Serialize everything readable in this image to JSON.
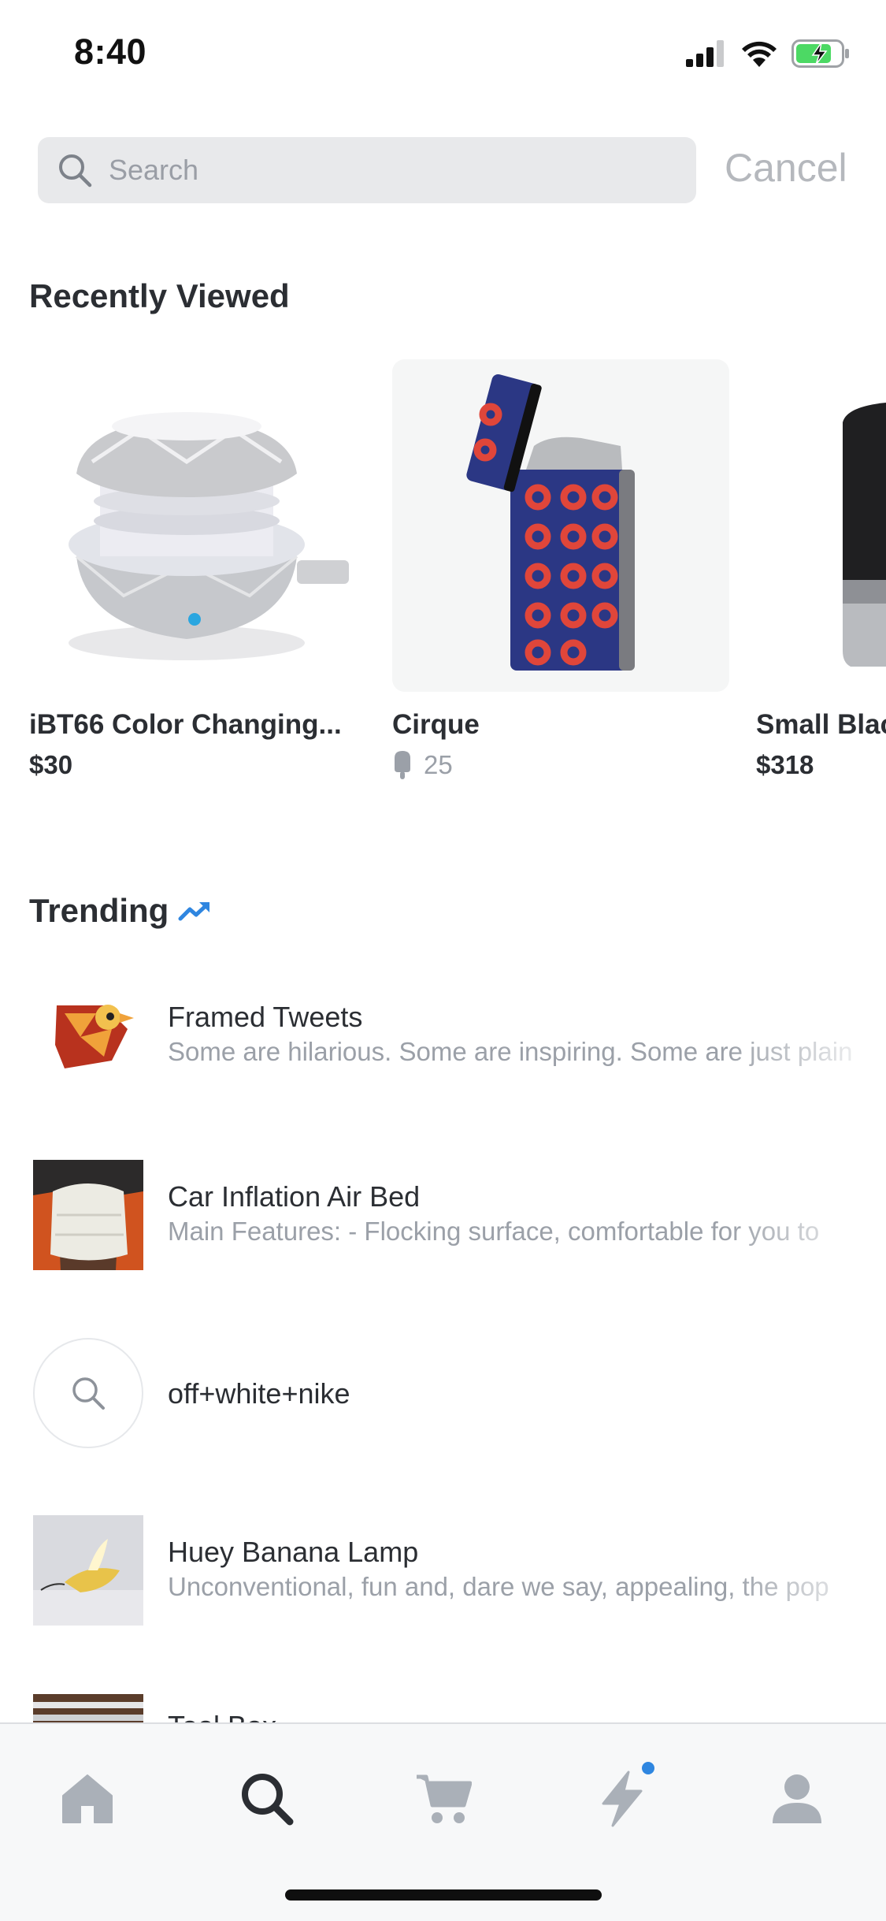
{
  "status_bar": {
    "time": "8:40"
  },
  "search": {
    "placeholder": "Search",
    "value": "",
    "cancel_label": "Cancel"
  },
  "recently_viewed": {
    "title": "Recently Viewed",
    "items": [
      {
        "title": "iBT66 Color Changing...",
        "price": "$30"
      },
      {
        "title": "Cirque",
        "count": "25"
      },
      {
        "title": "Small Black",
        "price": "$318"
      }
    ]
  },
  "trending": {
    "title": "Trending",
    "items": [
      {
        "title": "Framed Tweets",
        "description": "Some are hilarious. Some are inspiring. Some are just plain"
      },
      {
        "title": "Car Inflation Air Bed",
        "description": "Main Features: - Flocking surface, comfortable for you to"
      },
      {
        "title": "off+white+nike"
      },
      {
        "title": "Huey Banana Lamp",
        "description": "Unconventional, fun and, dare we say, appealing, the pop"
      },
      {
        "title": "Tool Box"
      }
    ]
  },
  "tab_bar": {
    "tabs": [
      {
        "icon": "home-icon",
        "active": false
      },
      {
        "icon": "search-icon",
        "active": true
      },
      {
        "icon": "cart-icon",
        "active": false
      },
      {
        "icon": "lightning-icon",
        "active": false,
        "badge": true
      },
      {
        "icon": "profile-icon",
        "active": false
      }
    ]
  },
  "colors": {
    "accent": "#2f86e0",
    "text": "#2b2e33",
    "muted": "#9ba0a8",
    "tab_inactive": "#aab0b8",
    "tab_active": "#2b2e33"
  }
}
